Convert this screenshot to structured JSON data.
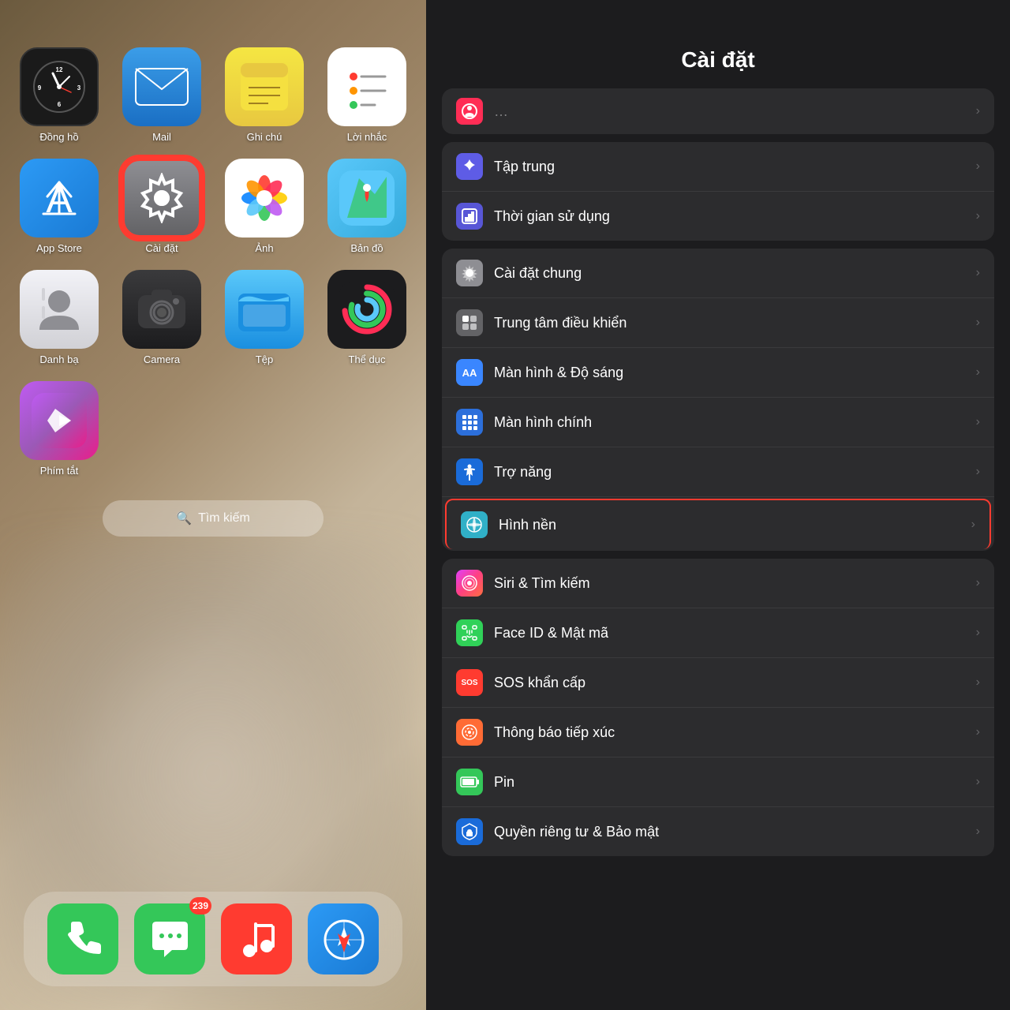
{
  "left": {
    "apps": [
      {
        "id": "clock",
        "label": "Đồng hồ",
        "iconType": "clock"
      },
      {
        "id": "mail",
        "label": "Mail",
        "iconType": "mail"
      },
      {
        "id": "notes",
        "label": "Ghi chú",
        "iconType": "notes"
      },
      {
        "id": "reminders",
        "label": "Lời nhắc",
        "iconType": "reminders"
      },
      {
        "id": "appstore",
        "label": "App Store",
        "iconType": "appstore"
      },
      {
        "id": "settings",
        "label": "Cài đặt",
        "iconType": "settings",
        "highlighted": true
      },
      {
        "id": "photos",
        "label": "Ảnh",
        "iconType": "photos"
      },
      {
        "id": "maps",
        "label": "Bản đồ",
        "iconType": "maps"
      },
      {
        "id": "contacts",
        "label": "Danh bạ",
        "iconType": "contacts"
      },
      {
        "id": "camera",
        "label": "Camera",
        "iconType": "camera"
      },
      {
        "id": "files",
        "label": "Tệp",
        "iconType": "files"
      },
      {
        "id": "fitness",
        "label": "Thể dục",
        "iconType": "fitness"
      },
      {
        "id": "shortcuts",
        "label": "Phím tắt",
        "iconType": "shortcuts"
      }
    ],
    "search": {
      "placeholder": "Tìm kiếm"
    },
    "dock": [
      {
        "id": "phone",
        "label": "Phone",
        "iconType": "phone",
        "badge": null
      },
      {
        "id": "messages",
        "label": "Messages",
        "iconType": "messages",
        "badge": "239"
      },
      {
        "id": "music",
        "label": "Music",
        "iconType": "music",
        "badge": null
      },
      {
        "id": "safari",
        "label": "Safari",
        "iconType": "safari",
        "badge": null
      }
    ]
  },
  "right": {
    "title": "Cài đặt",
    "topPartial": {
      "iconType": "pink-circle",
      "label": ""
    },
    "groups": [
      {
        "items": [
          {
            "id": "focus",
            "label": "Tập trung",
            "iconType": "focus",
            "iconEmoji": "🌙",
            "iconBg": "#5e5ce6"
          },
          {
            "id": "screentime",
            "label": "Thời gian sử dụng",
            "iconType": "screentime",
            "iconEmoji": "⏳",
            "iconBg": "#5856d6"
          }
        ]
      },
      {
        "items": [
          {
            "id": "general",
            "label": "Cài đặt chung",
            "iconType": "general",
            "iconEmoji": "⚙️",
            "iconBg": "#8e8e93"
          },
          {
            "id": "control",
            "label": "Trung tâm điều khiển",
            "iconType": "control",
            "iconEmoji": "▣",
            "iconBg": "#636366"
          },
          {
            "id": "display",
            "label": "Màn hình & Độ sáng",
            "iconType": "display",
            "iconEmoji": "AA",
            "iconBg": "#3a86ff"
          },
          {
            "id": "homescreen",
            "label": "Màn hình chính",
            "iconType": "homescreen",
            "iconEmoji": "⠿",
            "iconBg": "#2c6fdb"
          },
          {
            "id": "accessibility",
            "label": "Trợ năng",
            "iconType": "accessibility",
            "iconEmoji": "♿",
            "iconBg": "#1a6bd9"
          },
          {
            "id": "wallpaper",
            "label": "Hình nền",
            "iconType": "wallpaper",
            "iconEmoji": "❋",
            "iconBg": "#30b0c7",
            "highlighted": true
          }
        ]
      },
      {
        "items": [
          {
            "id": "siri",
            "label": "Siri & Tìm kiếm",
            "iconType": "siri",
            "iconEmoji": "◎",
            "iconBg": "gradient"
          },
          {
            "id": "faceid",
            "label": "Face ID & Mật mã",
            "iconType": "faceid",
            "iconEmoji": "🙂",
            "iconBg": "#30d158"
          },
          {
            "id": "sos",
            "label": "SOS khẩn cấp",
            "iconType": "sos",
            "iconEmoji": "SOS",
            "iconBg": "#ff3b30"
          },
          {
            "id": "contact",
            "label": "Thông báo tiếp xúc",
            "iconType": "contact",
            "iconEmoji": "◉",
            "iconBg": "#ff6b35"
          },
          {
            "id": "battery",
            "label": "Pin",
            "iconType": "battery",
            "iconEmoji": "🔋",
            "iconBg": "#34c759"
          },
          {
            "id": "privacy",
            "label": "Quyền riêng tư & Bảo mật",
            "iconType": "privacy",
            "iconEmoji": "✋",
            "iconBg": "#1a6bd9"
          }
        ]
      }
    ]
  }
}
